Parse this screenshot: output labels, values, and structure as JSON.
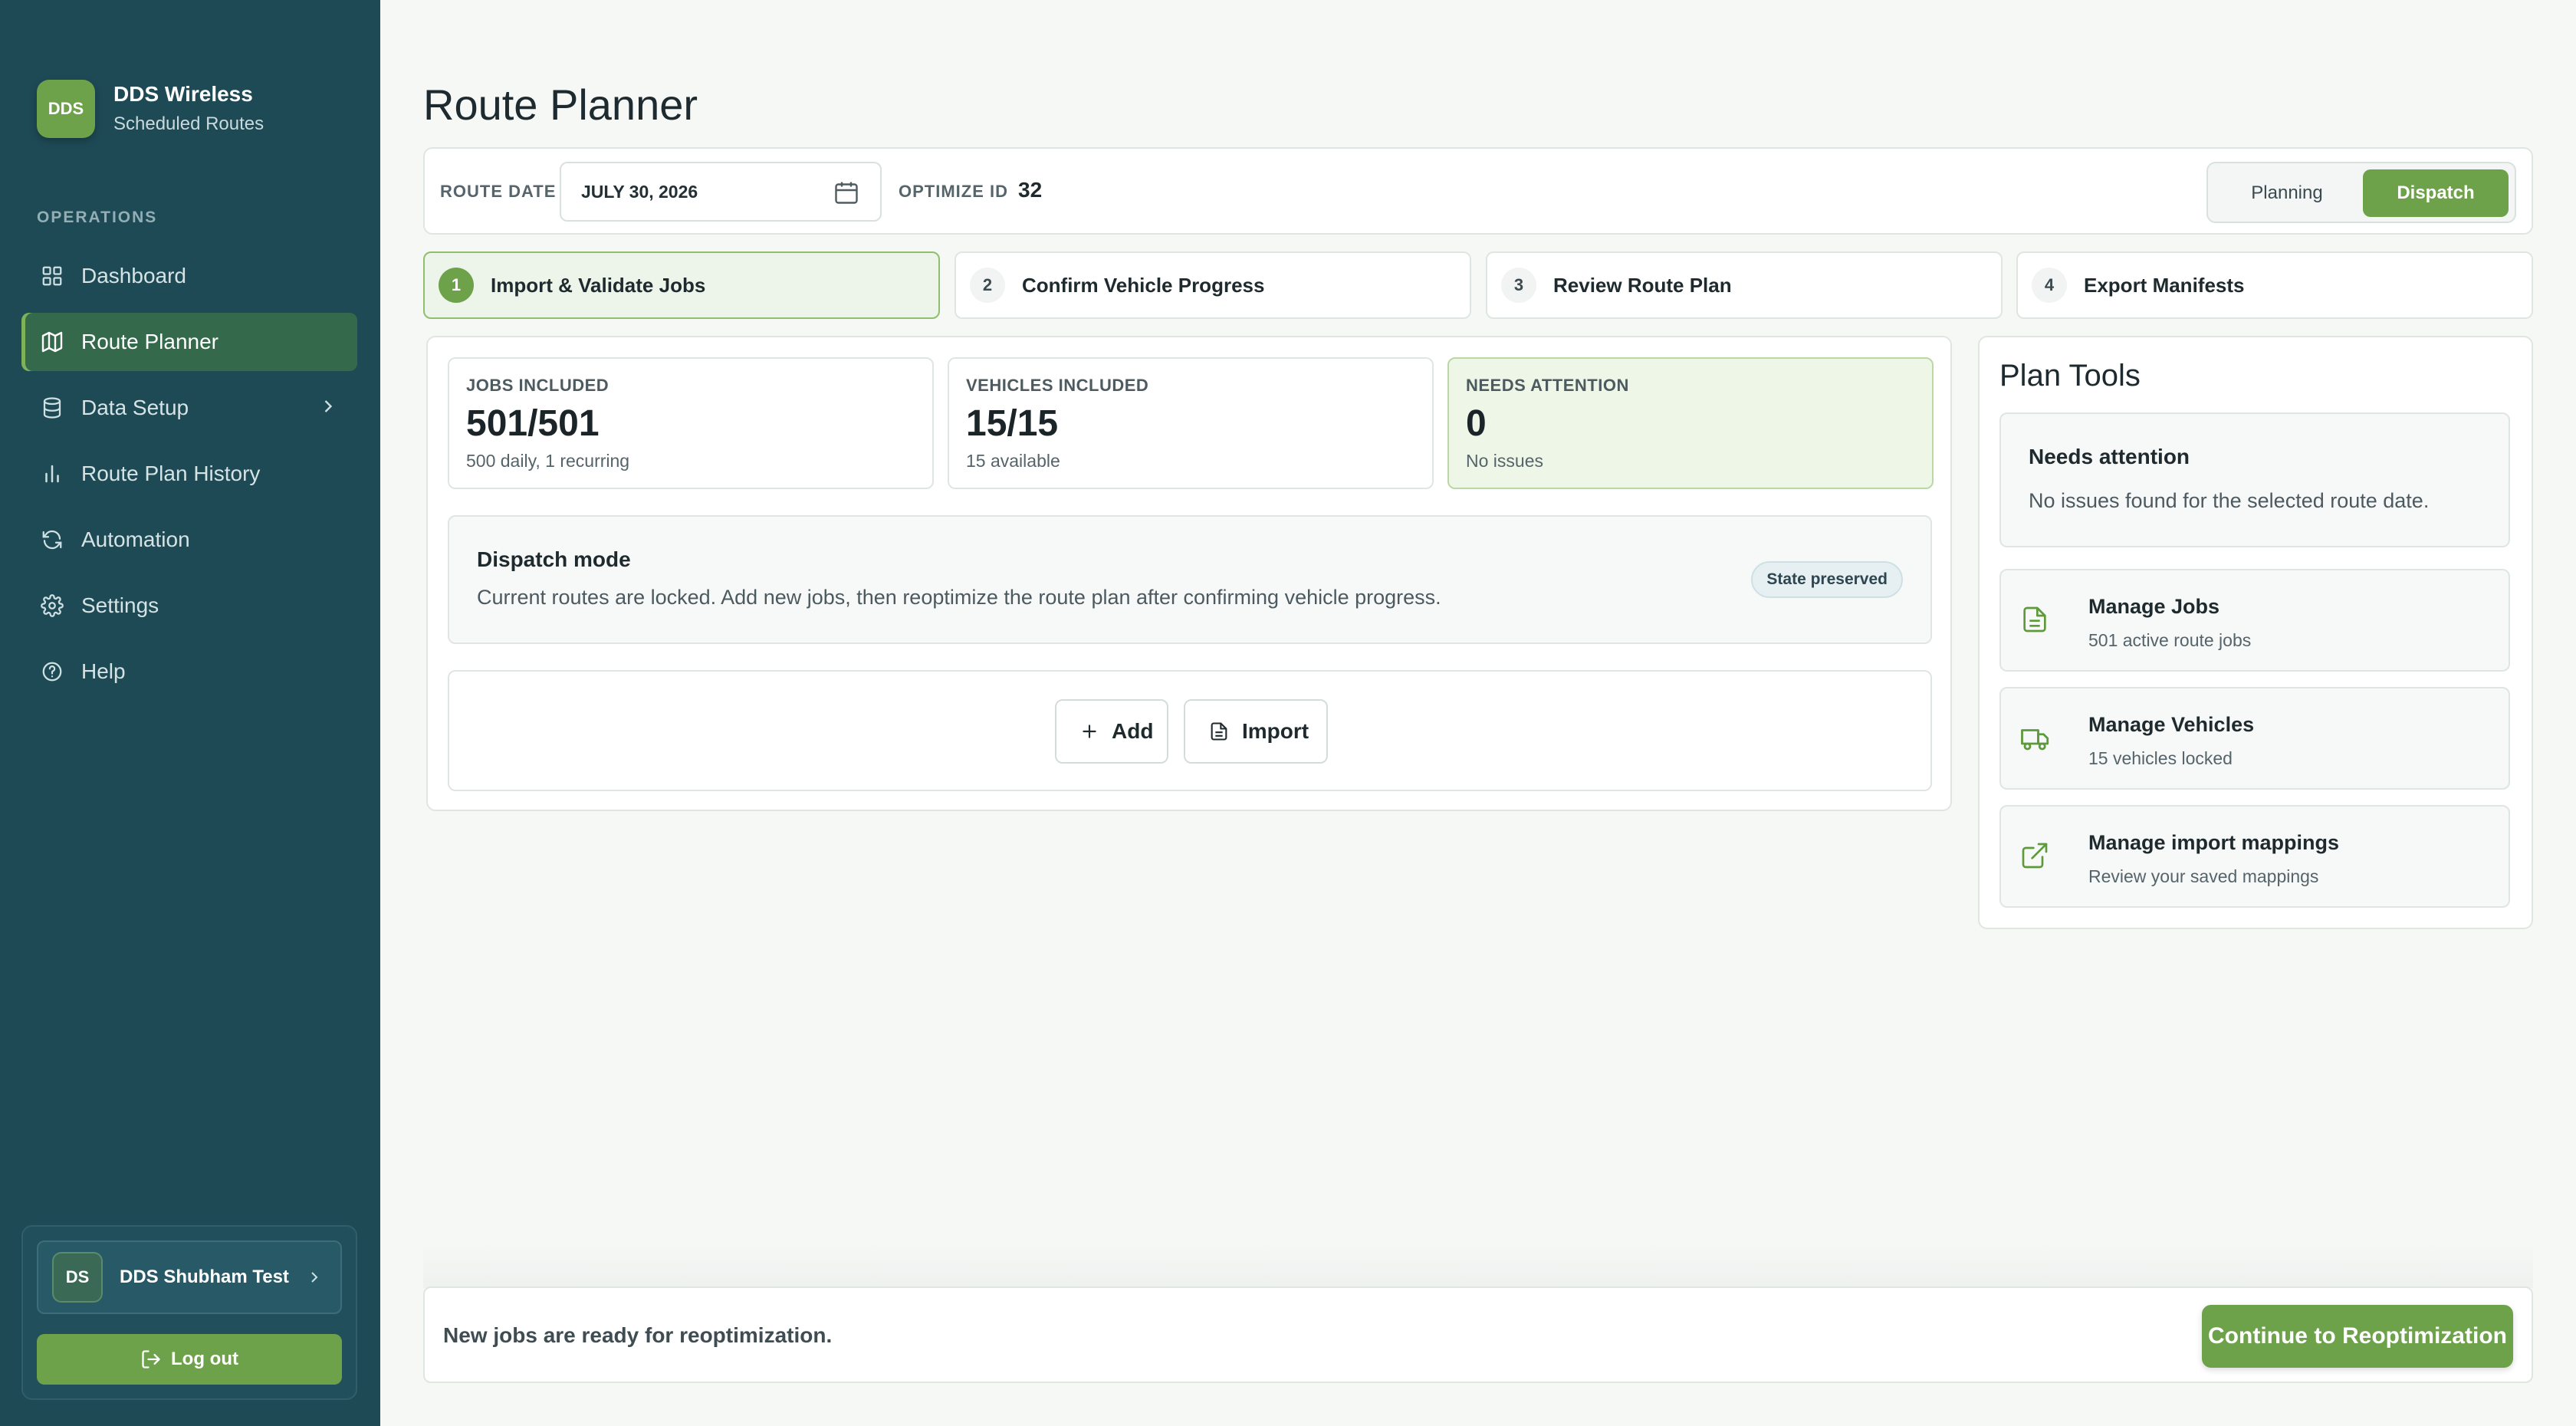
{
  "sidebar": {
    "brand": {
      "logo_text": "DDS",
      "name": "DDS Wireless",
      "subtitle": "Scheduled Routes"
    },
    "section_label": "OPERATIONS",
    "items": [
      {
        "label": "Dashboard",
        "icon": "grid-icon"
      },
      {
        "label": "Route Planner",
        "icon": "map-icon",
        "active": true
      },
      {
        "label": "Data Setup",
        "icon": "database-icon",
        "has_submenu": true
      },
      {
        "label": "Route Plan History",
        "icon": "bar-chart-icon"
      },
      {
        "label": "Automation",
        "icon": "refresh-icon"
      },
      {
        "label": "Settings",
        "icon": "gear-icon"
      },
      {
        "label": "Help",
        "icon": "help-icon"
      }
    ],
    "user": {
      "initials": "DS",
      "name": "DDS Shubham Test"
    },
    "logout_label": "Log out"
  },
  "page": {
    "title": "Route Planner"
  },
  "toolbar": {
    "route_date_label": "ROUTE DATE",
    "route_date_value": "JULY 30, 2026",
    "optimize_id_label": "OPTIMIZE ID",
    "optimize_id_value": "32",
    "modes": [
      "Planning",
      "Dispatch"
    ],
    "active_mode": "Dispatch"
  },
  "steps": [
    {
      "num": "1",
      "label": "Import & Validate Jobs",
      "active": true
    },
    {
      "num": "2",
      "label": "Confirm Vehicle Progress"
    },
    {
      "num": "3",
      "label": "Review Route Plan"
    },
    {
      "num": "4",
      "label": "Export Manifests"
    }
  ],
  "stats": [
    {
      "label": "JOBS INCLUDED",
      "value": "501/501",
      "sub": "500 daily, 1 recurring"
    },
    {
      "label": "VEHICLES INCLUDED",
      "value": "15/15",
      "sub": "15 available"
    },
    {
      "label": "NEEDS ATTENTION",
      "value": "0",
      "sub": "No issues"
    }
  ],
  "dispatch": {
    "title": "Dispatch mode",
    "description": "Current routes are locked. Add new jobs, then reoptimize the route plan after confirming vehicle progress.",
    "badge": "State preserved"
  },
  "actions": {
    "add_label": "Add",
    "import_label": "Import"
  },
  "plan_tools": {
    "title": "Plan Tools",
    "needs_attention": {
      "title": "Needs attention",
      "description": "No issues found for the selected route date."
    },
    "tools": [
      {
        "name": "Manage Jobs",
        "sub": "501 active route jobs",
        "icon": "document-icon"
      },
      {
        "name": "Manage Vehicles",
        "sub": "15 vehicles locked",
        "icon": "truck-icon"
      },
      {
        "name": "Manage import mappings",
        "sub": "Review your saved mappings",
        "icon": "external-link-icon"
      }
    ]
  },
  "footer": {
    "message": "New jobs are ready for reoptimization.",
    "continue_label": "Continue to Reoptimization"
  },
  "colors": {
    "sidebar_bg": "#1e4a56",
    "accent_green": "#6da24a",
    "active_nav": "#346a4b",
    "attention_bg": "#eef6e8"
  }
}
